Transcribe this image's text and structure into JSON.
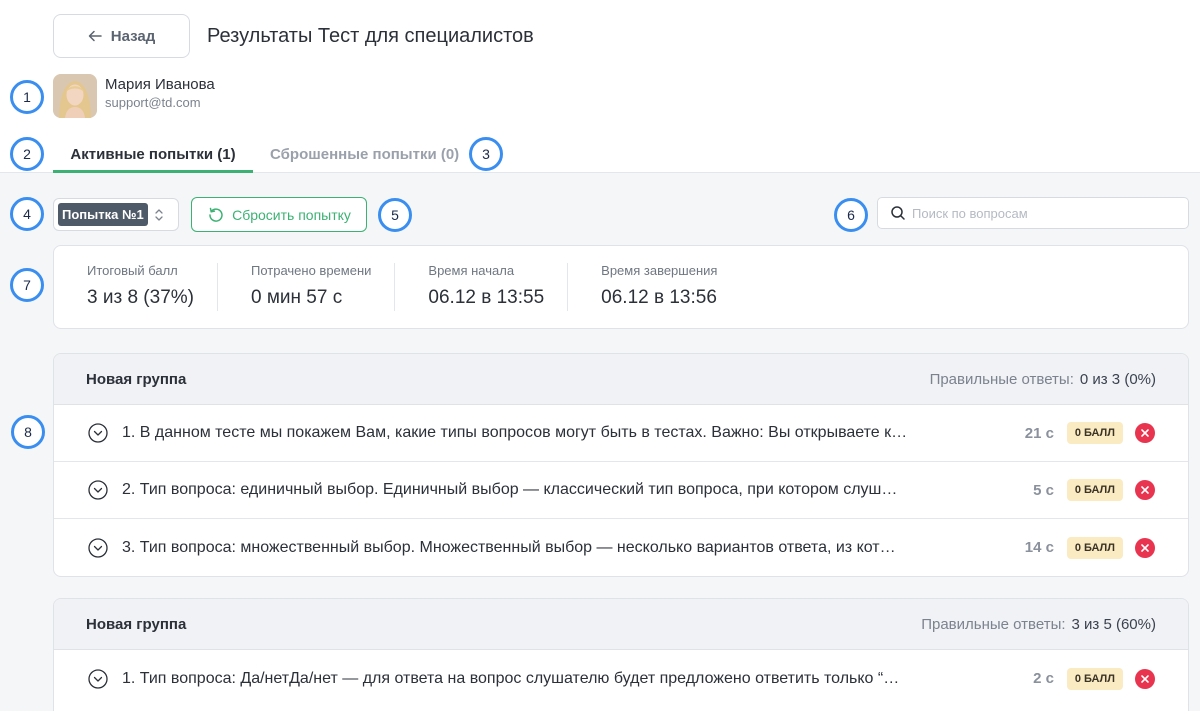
{
  "header": {
    "back_label": "Назад",
    "title": "Результаты Тест для специалистов"
  },
  "user": {
    "name": "Мария Иванова",
    "email": "support@td.com"
  },
  "tabs": {
    "active": "Активные попытки (1)",
    "reset": "Сброшенные попытки (0)"
  },
  "toolbar": {
    "attempt_selected": "Попытка №1",
    "reset_label": "Сбросить попытку",
    "search_placeholder": "Поиск по вопросам"
  },
  "stats": [
    {
      "label": "Итоговый балл",
      "value": "3 из 8 (37%)"
    },
    {
      "label": "Потрачено времени",
      "value": "0 мин 57 с"
    },
    {
      "label": "Время начала",
      "value": "06.12 в 13:55"
    },
    {
      "label": "Время завершения",
      "value": "06.12 в 13:56"
    }
  ],
  "groups": [
    {
      "title": "Новая группа",
      "correct_label": "Правильные ответы:",
      "correct_value": "0 из 3 (0%)",
      "questions": [
        {
          "text": "1. В данном тесте мы покажем Вам, какие типы вопросов могут быть в тестах. Важно: Вы открываете к…",
          "time": "21 с",
          "score": "0 БАЛЛ"
        },
        {
          "text": "2. Тип вопроса: единичный выбор. Единичный выбор — классический тип вопроса, при котором слуш…",
          "time": "5 с",
          "score": "0 БАЛЛ"
        },
        {
          "text": "3. Тип вопроса: множественный выбор. Множественный выбор — несколько вариантов ответа, из кот…",
          "time": "14 с",
          "score": "0 БАЛЛ"
        }
      ]
    },
    {
      "title": "Новая группа",
      "correct_label": "Правильные ответы:",
      "correct_value": "3 из 5 (60%)",
      "questions": [
        {
          "text": "1. Тип вопроса: Да/нетДа/нет — для ответа на вопрос слушателю будет предложено ответить только “…",
          "time": "2 с",
          "score": "0 БАЛЛ"
        }
      ]
    }
  ],
  "markers": [
    "1",
    "2",
    "3",
    "4",
    "5",
    "6",
    "7",
    "8"
  ],
  "colors": {
    "accent_green": "#3bb273",
    "marker_blue": "#3a8ef0",
    "wrong_red": "#e8344e",
    "score_badge_bg": "#fbebc2"
  }
}
